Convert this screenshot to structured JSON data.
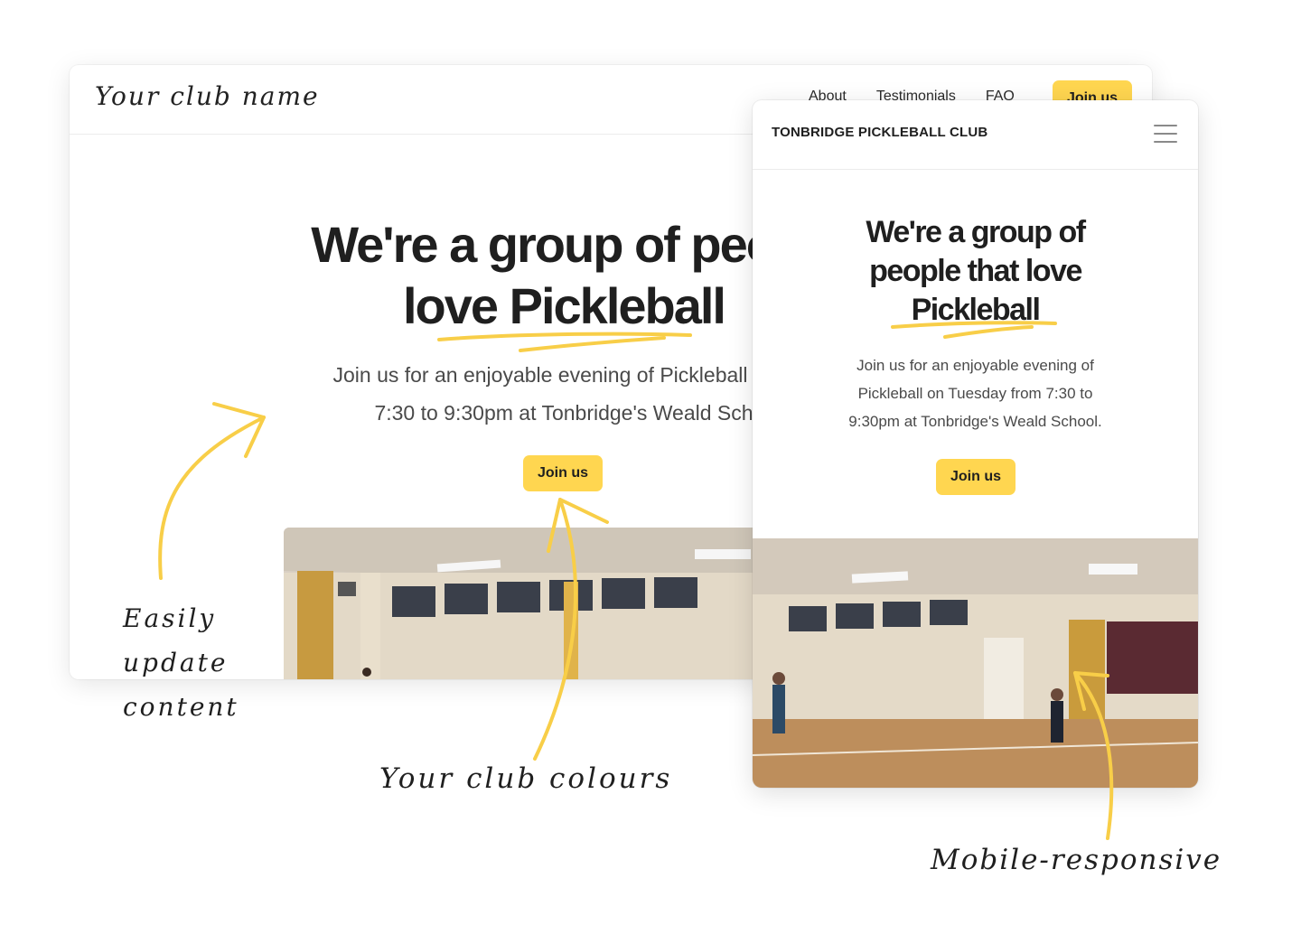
{
  "desktop": {
    "logo": "Your club name",
    "nav": [
      "About",
      "Testimonials",
      "FAQ"
    ],
    "nav_cta": "Join us",
    "hero_line1": "We're a group of peopl",
    "hero_line2": "love Pickleball",
    "sub_line1": "Join us for an enjoyable evening of Pickleball on T",
    "sub_line2": "7:30 to 9:30pm at Tonbridge's Weald Sch",
    "cta": "Join us"
  },
  "mobile": {
    "title": "TONBRIDGE PICKLEBALL CLUB",
    "hero_line1": "We're a group of",
    "hero_line2": "people that love",
    "hero_line3": "Pickleball",
    "sub_line1": "Join us for an enjoyable evening of",
    "sub_line2": "Pickleball on Tuesday from 7:30 to",
    "sub_line3": "9:30pm at Tonbridge's Weald School.",
    "cta": "Join us"
  },
  "annotations": {
    "content": [
      "Easily",
      "update",
      "content"
    ],
    "colours": "Your club colours",
    "mobile": "Mobile-responsive"
  },
  "colors": {
    "accent": "#FFD650",
    "arrow": "#F8CE48",
    "text": "#1f1f1f"
  }
}
